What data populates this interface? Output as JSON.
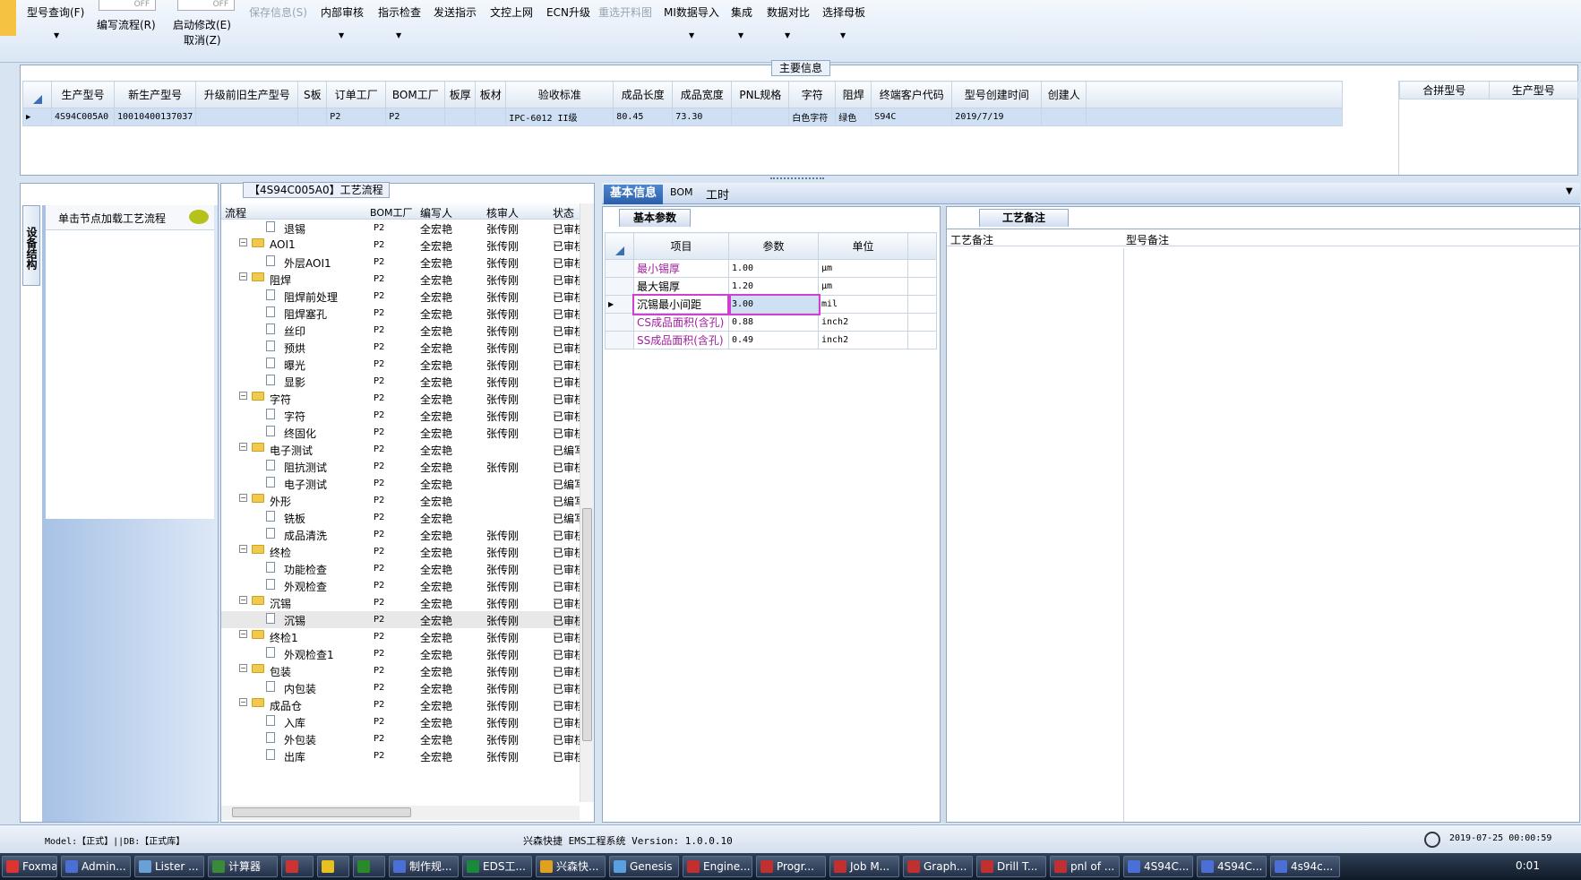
{
  "toolbar": {
    "query": "型号查询(F)",
    "edit_flow": "编写流程(R)",
    "start_modify": "启动修改(E)",
    "cancel": "取消(Z)",
    "toggle_off": "OFF",
    "save_info": "保存信息(S)",
    "internal_review": "内部审核",
    "instruction_check": "指示检查",
    "send_instruction": "发送指示",
    "doc_upload": "文控上网",
    "ecn_upgrade": "ECN升级",
    "reselect_material": "重选开料图",
    "mi_import": "MI数据导入",
    "integrate": "集成",
    "data_compare": "数据对比",
    "select_master": "选择母板"
  },
  "main_info": {
    "title": "主要信息",
    "columns": [
      "生产型号",
      "新生产型号",
      "升级前旧生产型号",
      "S板",
      "订单工厂",
      "BOM工厂",
      "板厚",
      "板材",
      "验收标准",
      "成品长度",
      "成品宽度",
      "PNL规格",
      "字符",
      "阻焊",
      "终端客户代码",
      "型号创建时间",
      "创建人"
    ],
    "row": [
      "4S94C005A0",
      "10010400137037",
      "",
      "",
      "P2",
      "P2",
      "",
      "",
      "IPC-6012 II级",
      "80.45",
      "73.30",
      "",
      "白色字符",
      "绿色",
      "S94C",
      "2019/7/19",
      ""
    ],
    "side_columns": [
      "合拼型号",
      "生产型号"
    ]
  },
  "left_tab": {
    "vertical_label": "设备结构",
    "hint": "单击节点加载工艺流程"
  },
  "process": {
    "title": "【4S94C005A0】工艺流程",
    "columns": [
      "流程",
      "BOM工厂",
      "编写人",
      "核审人",
      "状态"
    ],
    "rows": [
      {
        "name": "退锡",
        "level": 2,
        "bom": "P2",
        "writer": "全宏艳",
        "reviewer": "张传刚",
        "status": "已审核"
      },
      {
        "name": "AOI1",
        "level": 1,
        "bom": "P2",
        "writer": "全宏艳",
        "reviewer": "张传刚",
        "status": "已审核"
      },
      {
        "name": "外层AOI1",
        "level": 2,
        "bom": "P2",
        "writer": "全宏艳",
        "reviewer": "张传刚",
        "status": "已审核"
      },
      {
        "name": "阻焊",
        "level": 1,
        "bom": "P2",
        "writer": "全宏艳",
        "reviewer": "张传刚",
        "status": "已审核"
      },
      {
        "name": "阻焊前处理",
        "level": 2,
        "bom": "P2",
        "writer": "全宏艳",
        "reviewer": "张传刚",
        "status": "已审核"
      },
      {
        "name": "阻焊塞孔",
        "level": 2,
        "bom": "P2",
        "writer": "全宏艳",
        "reviewer": "张传刚",
        "status": "已审核"
      },
      {
        "name": "丝印",
        "level": 2,
        "bom": "P2",
        "writer": "全宏艳",
        "reviewer": "张传刚",
        "status": "已审核"
      },
      {
        "name": "预烘",
        "level": 2,
        "bom": "P2",
        "writer": "全宏艳",
        "reviewer": "张传刚",
        "status": "已审核"
      },
      {
        "name": "曝光",
        "level": 2,
        "bom": "P2",
        "writer": "全宏艳",
        "reviewer": "张传刚",
        "status": "已审核"
      },
      {
        "name": "显影",
        "level": 2,
        "bom": "P2",
        "writer": "全宏艳",
        "reviewer": "张传刚",
        "status": "已审核"
      },
      {
        "name": "字符",
        "level": 1,
        "bom": "P2",
        "writer": "全宏艳",
        "reviewer": "张传刚",
        "status": "已审核"
      },
      {
        "name": "字符",
        "level": 2,
        "bom": "P2",
        "writer": "全宏艳",
        "reviewer": "张传刚",
        "status": "已审核"
      },
      {
        "name": "终固化",
        "level": 2,
        "bom": "P2",
        "writer": "全宏艳",
        "reviewer": "张传刚",
        "status": "已审核"
      },
      {
        "name": "电子测试",
        "level": 1,
        "bom": "P2",
        "writer": "全宏艳",
        "reviewer": "",
        "status": "已编写"
      },
      {
        "name": "阻抗测试",
        "level": 2,
        "bom": "P2",
        "writer": "全宏艳",
        "reviewer": "张传刚",
        "status": "已审核"
      },
      {
        "name": "电子测试",
        "level": 2,
        "bom": "P2",
        "writer": "全宏艳",
        "reviewer": "",
        "status": "已编写"
      },
      {
        "name": "外形",
        "level": 1,
        "bom": "P2",
        "writer": "全宏艳",
        "reviewer": "",
        "status": "已编写"
      },
      {
        "name": "铣板",
        "level": 2,
        "bom": "P2",
        "writer": "全宏艳",
        "reviewer": "",
        "status": "已编写"
      },
      {
        "name": "成品清洗",
        "level": 2,
        "bom": "P2",
        "writer": "全宏艳",
        "reviewer": "张传刚",
        "status": "已审核"
      },
      {
        "name": "终检",
        "level": 1,
        "bom": "P2",
        "writer": "全宏艳",
        "reviewer": "张传刚",
        "status": "已审核"
      },
      {
        "name": "功能检查",
        "level": 2,
        "bom": "P2",
        "writer": "全宏艳",
        "reviewer": "张传刚",
        "status": "已审核"
      },
      {
        "name": "外观检查",
        "level": 2,
        "bom": "P2",
        "writer": "全宏艳",
        "reviewer": "张传刚",
        "status": "已审核"
      },
      {
        "name": "沉锡",
        "level": 1,
        "bom": "P2",
        "writer": "全宏艳",
        "reviewer": "张传刚",
        "status": "已审核"
      },
      {
        "name": "沉锡",
        "level": 2,
        "bom": "P2",
        "writer": "全宏艳",
        "reviewer": "张传刚",
        "status": "已审核"
      },
      {
        "name": "终检1",
        "level": 1,
        "bom": "P2",
        "writer": "全宏艳",
        "reviewer": "张传刚",
        "status": "已审核"
      },
      {
        "name": "外观检查1",
        "level": 2,
        "bom": "P2",
        "writer": "全宏艳",
        "reviewer": "张传刚",
        "status": "已审核"
      },
      {
        "name": "包装",
        "level": 1,
        "bom": "P2",
        "writer": "全宏艳",
        "reviewer": "张传刚",
        "status": "已审核"
      },
      {
        "name": "内包装",
        "level": 2,
        "bom": "P2",
        "writer": "全宏艳",
        "reviewer": "张传刚",
        "status": "已审核"
      },
      {
        "name": "成品仓",
        "level": 1,
        "bom": "P2",
        "writer": "全宏艳",
        "reviewer": "张传刚",
        "status": "已审核"
      },
      {
        "name": "入库",
        "level": 2,
        "bom": "P2",
        "writer": "全宏艳",
        "reviewer": "张传刚",
        "status": "已审核"
      },
      {
        "name": "外包装",
        "level": 2,
        "bom": "P2",
        "writer": "全宏艳",
        "reviewer": "张传刚",
        "status": "已审核"
      },
      {
        "name": "出库",
        "level": 2,
        "bom": "P2",
        "writer": "全宏艳",
        "reviewer": "张传刚",
        "status": "已审核"
      }
    ]
  },
  "info_tabs": [
    "基本信息",
    "BOM",
    "工时"
  ],
  "basic_params": {
    "tab": "基本参数",
    "columns": [
      "项目",
      "参数",
      "单位"
    ],
    "rows": [
      {
        "item": "最小锡厚",
        "value": "1.00",
        "unit": "μm",
        "color": "#a0209c"
      },
      {
        "item": "最大锡厚",
        "value": "1.20",
        "unit": "μm",
        "color": "#000000"
      },
      {
        "item": "沉锡最小间距",
        "value": "3.00",
        "unit": "mil",
        "color": "#000000"
      },
      {
        "item": "CS成品面积(含孔)",
        "value": "0.88",
        "unit": "inch2",
        "color": "#a0209c"
      },
      {
        "item": "SS成品面积(含孔)",
        "value": "0.49",
        "unit": "inch2",
        "color": "#a0209c"
      }
    ],
    "highlight_color": "#d040d0"
  },
  "remarks": {
    "tab": "工艺备注",
    "process_note": "工艺备注",
    "model_note": "型号备注"
  },
  "status_bar": {
    "model": "Model:【正式】||DB:【正式库】",
    "system": "兴森快捷 EMS工程系统 Version: 1.0.0.10",
    "datetime": "2019-07-25 00:00:59"
  },
  "taskbar": {
    "items": [
      "Foxmail",
      "Admin...",
      "Lister ...",
      "计算器",
      "",
      "",
      "",
      "制作规...",
      "EDS工...",
      "兴森快...",
      "Genesis",
      "Engine...",
      "Progr...",
      "Job M...",
      "Graph...",
      "Drill T...",
      "pnl of ...",
      "4S94C...",
      "4S94C...",
      "4s94c..."
    ],
    "clock": "0:01"
  }
}
